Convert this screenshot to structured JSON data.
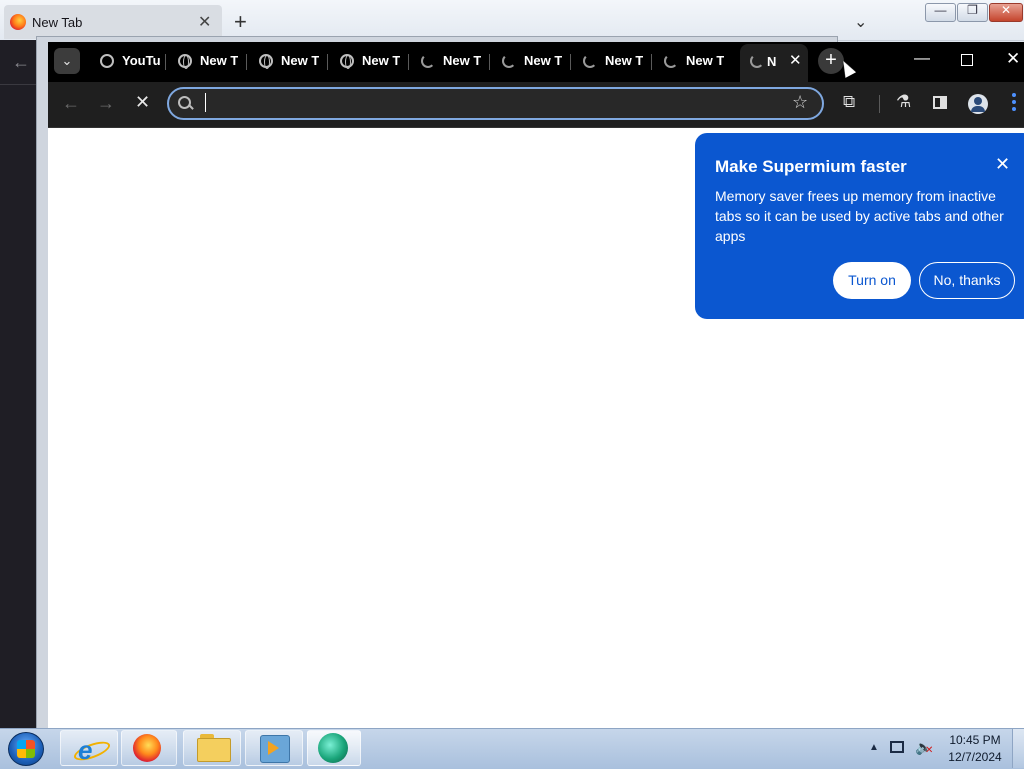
{
  "firefox": {
    "tab_title": "New Tab",
    "tab_close": "✕",
    "new_tab": "+",
    "list_all_tabs": "⌄",
    "back": "←"
  },
  "window_controls": {
    "minimize": "—",
    "restore": "❐",
    "close": "✕"
  },
  "supermium": {
    "tab_search": "⌄",
    "tabs": [
      {
        "label": "YouTu",
        "icon": "youtube-icon"
      },
      {
        "label": "New T",
        "icon": "globe-icon"
      },
      {
        "label": "New T",
        "icon": "globe-icon"
      },
      {
        "label": "New T",
        "icon": "globe-icon"
      },
      {
        "label": "New T",
        "icon": "loading-icon"
      },
      {
        "label": "New T",
        "icon": "loading-icon"
      },
      {
        "label": "New T",
        "icon": "loading-icon"
      },
      {
        "label": "New T",
        "icon": "loading-icon"
      }
    ],
    "active_tab": {
      "label": "N",
      "close": "✕",
      "icon": "loading-icon"
    },
    "new_tab": "+",
    "window_controls": {
      "minimize": "—",
      "close": "✕"
    },
    "nav": {
      "back": "←",
      "forward": "→",
      "stop": "✕"
    },
    "omnibox": {
      "value": "",
      "placeholder": ""
    },
    "toolbar_icons": [
      "star-icon",
      "extensions-icon",
      "labs-icon",
      "side-panel-icon",
      "profile-icon",
      "menu-icon"
    ],
    "glyphs": {
      "star": "☆",
      "extensions": "⧉",
      "labs": "⚗"
    }
  },
  "promo": {
    "title": "Make Supermium faster",
    "body": "Memory saver frees up memory from inactive tabs so it can be used by active tabs and other apps",
    "close": "✕",
    "primary_button": "Turn on",
    "secondary_button": "No, thanks",
    "background_color": "#0b57d0"
  },
  "taskbar": {
    "apps": [
      "internet-explorer",
      "firefox",
      "file-explorer",
      "media-player",
      "supermium"
    ],
    "ie_glyph": "e",
    "tray_arrow": "▲",
    "volume_glyph": "🔈",
    "volume_muted": "✕",
    "clock_time": "10:45 PM",
    "clock_date": "12/7/2024"
  }
}
